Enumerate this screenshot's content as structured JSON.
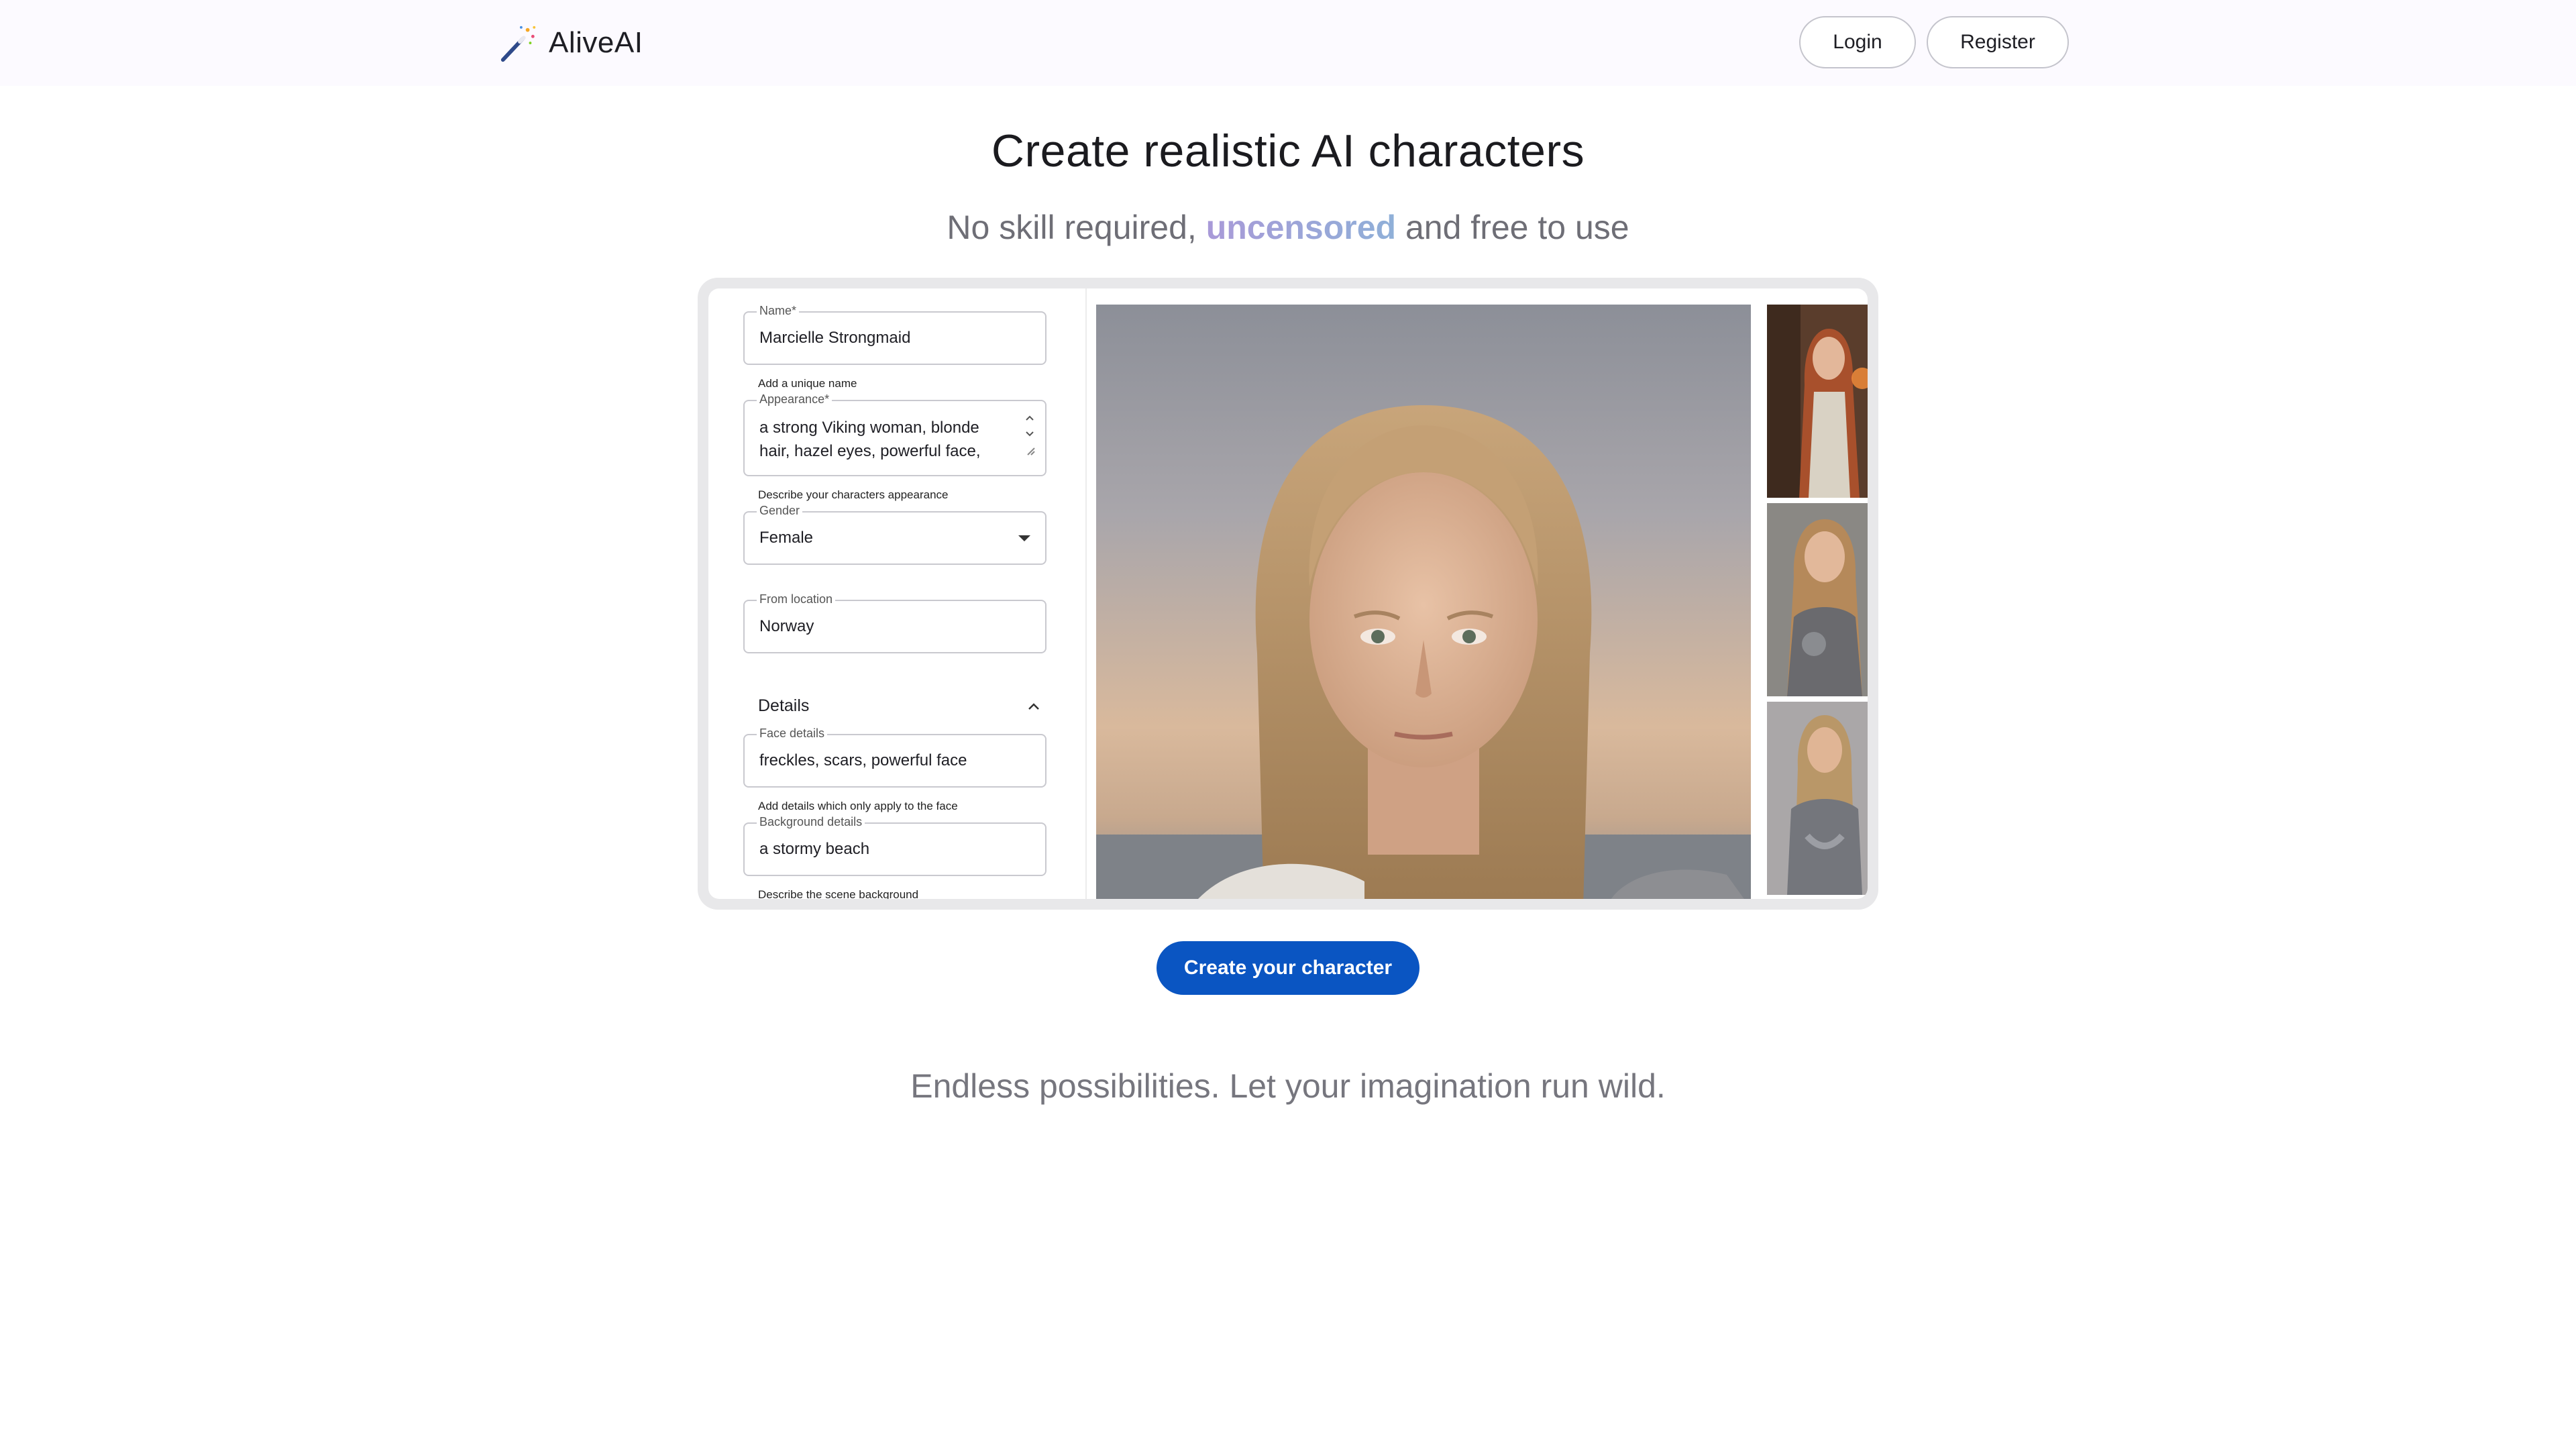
{
  "header": {
    "brand": "AliveAI",
    "login_label": "Login",
    "register_label": "Register",
    "logo_icon": "magic-wand-icon"
  },
  "hero": {
    "title": "Create realistic AI characters",
    "subtitle_before": "No skill required, ",
    "subtitle_highlight": "uncensored",
    "subtitle_after": " and free to use"
  },
  "form": {
    "name": {
      "label": "Name*",
      "value": "Marcielle Strongmaid",
      "helper": "Add a unique name"
    },
    "appearance": {
      "label": "Appearance*",
      "value": "a strong Viking woman, blonde hair, hazel eyes, powerful face,",
      "helper": "Describe your characters appearance"
    },
    "gender": {
      "label": "Gender",
      "value": "Female"
    },
    "location": {
      "label": "From location",
      "value": "Norway"
    },
    "details": {
      "label": "Details",
      "face": {
        "label": "Face details",
        "value": "freckles, scars, powerful face",
        "helper": "Add details which only apply to the face"
      },
      "background": {
        "label": "Background details",
        "value": "a stormy beach",
        "helper": "Describe the scene background"
      }
    }
  },
  "cta_label": "Create your character",
  "tagline": "Endless possibilities. Let your imagination run wild.",
  "colors": {
    "brand_blue": "#0a55c2",
    "highlight_start": "#a99ad8",
    "highlight_end": "#8fb0d8"
  }
}
